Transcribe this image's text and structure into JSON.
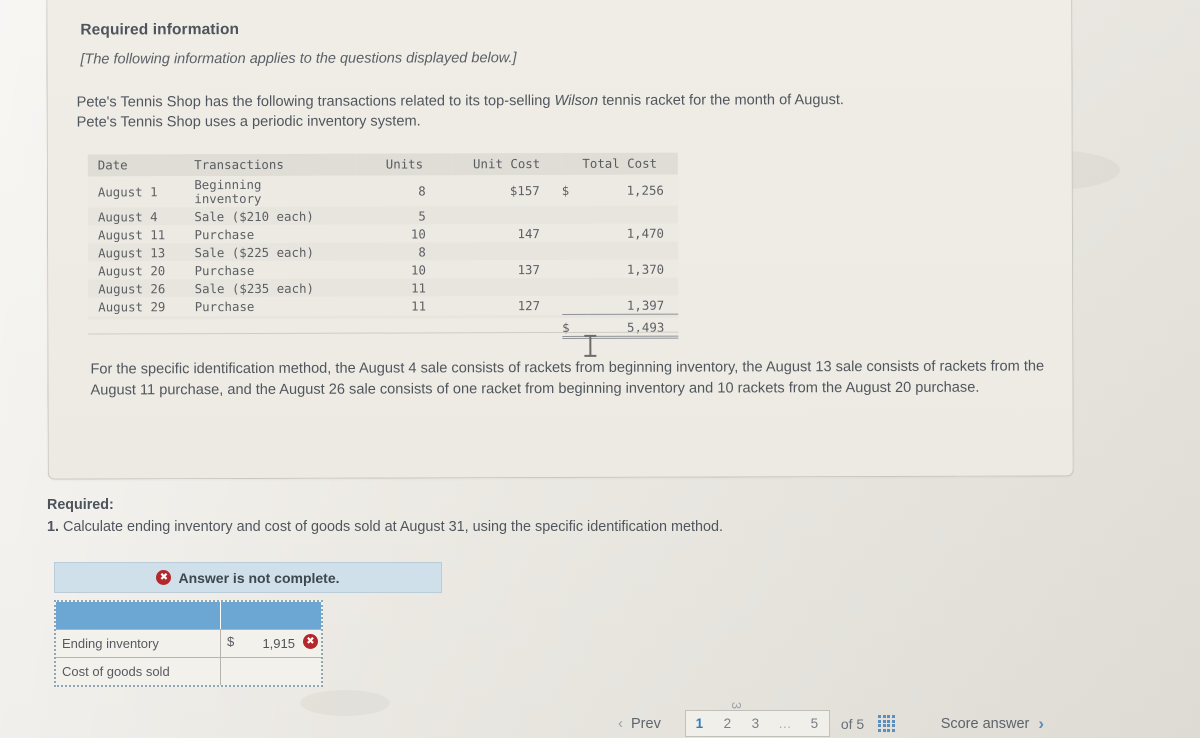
{
  "card": {
    "title": "Required information",
    "note": "[The following information applies to the questions displayed below.]",
    "intro_line1_a": "Pete's Tennis Shop has the following transactions related to its top-selling ",
    "intro_italic": "Wilson",
    "intro_line1_b": " tennis racket for the month of August.",
    "intro_line2": "Pete's Tennis Shop uses a periodic inventory system."
  },
  "table": {
    "headers": {
      "date": "Date",
      "transactions": "Transactions",
      "units": "Units",
      "unit_cost": "Unit Cost",
      "total_cost": "Total Cost"
    },
    "rows": [
      {
        "date": "August  1",
        "transaction": "Beginning inventory",
        "units": "8",
        "unit_cost": "$157",
        "dollar": "$",
        "total_cost": "1,256",
        "wrap": true
      },
      {
        "date": "August  4",
        "transaction": "Sale ($210 each)",
        "units": "5",
        "unit_cost": "",
        "dollar": "",
        "total_cost": "",
        "wrap": false
      },
      {
        "date": "August 11",
        "transaction": "Purchase",
        "units": "10",
        "unit_cost": "147",
        "dollar": "",
        "total_cost": "1,470",
        "wrap": false
      },
      {
        "date": "August 13",
        "transaction": "Sale ($225 each)",
        "units": "8",
        "unit_cost": "",
        "dollar": "",
        "total_cost": "",
        "wrap": false
      },
      {
        "date": "August 20",
        "transaction": "Purchase",
        "units": "10",
        "unit_cost": "137",
        "dollar": "",
        "total_cost": "1,370",
        "wrap": false
      },
      {
        "date": "August 26",
        "transaction": "Sale ($235 each)",
        "units": "11",
        "unit_cost": "",
        "dollar": "",
        "total_cost": "",
        "wrap": false
      },
      {
        "date": "August 29",
        "transaction": "Purchase",
        "units": "11",
        "unit_cost": "127",
        "dollar": "",
        "total_cost": "1,397",
        "wrap": false
      }
    ],
    "total": {
      "dollar": "$",
      "value": "5,493"
    }
  },
  "spec_para": "For the specific identification method, the August 4 sale consists of rackets from beginning inventory, the August 13 sale consists of rackets from the August 11 purchase, and the August 26 sale consists of one racket from beginning inventory and 10 rackets from the August 20 purchase.",
  "required": {
    "label": "Required:",
    "number": "1.",
    "text": " Calculate ending inventory and cost of goods sold at August 31, using the specific identification method."
  },
  "answer": {
    "banner_text": "Answer is not complete.",
    "banner_mark": "✖",
    "rows": [
      {
        "label": "Ending inventory",
        "dollar": "$",
        "value": "1,915",
        "mark": "✖",
        "has_mark": true
      },
      {
        "label": "Cost of goods sold",
        "dollar": "",
        "value": "",
        "mark": "",
        "has_mark": false
      }
    ]
  },
  "nav": {
    "prev_label": "Prev",
    "prev_chevron": "‹",
    "pages": [
      "1",
      "2",
      "3",
      "…",
      "5"
    ],
    "active_page": "1",
    "ghost_page": "3",
    "of_label": "of 5",
    "grid_icon": "grid-icon",
    "score_label": "Score answer",
    "score_chevron": "›"
  },
  "colors": {
    "accent_blue": "#2f7dbd",
    "header_blue": "#6ca7d4",
    "banner_blue": "#cfe0ea",
    "error_red": "#b3282d",
    "page_bg": "#eceae4"
  }
}
